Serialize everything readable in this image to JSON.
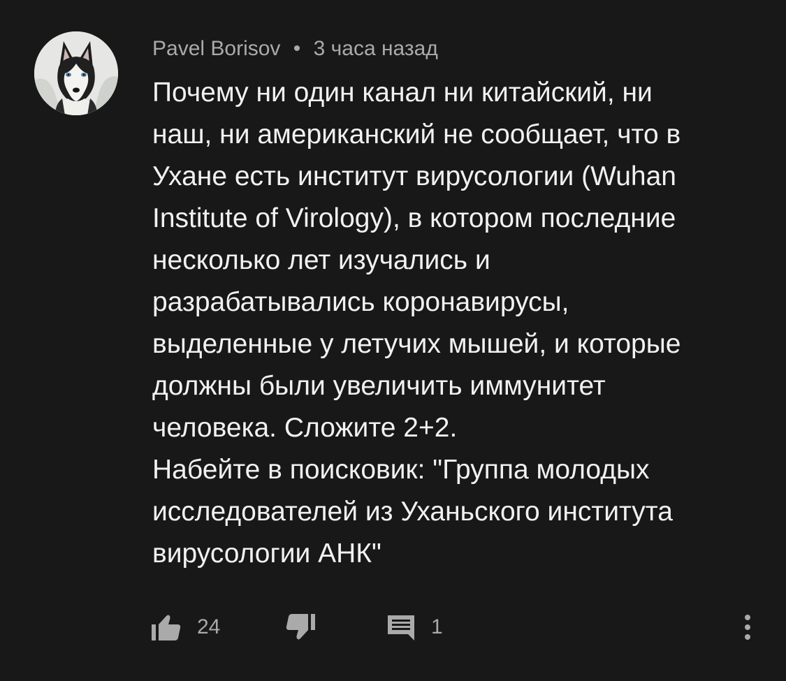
{
  "comment": {
    "author": "Pavel Borisov",
    "separator": "•",
    "time": "3 часа назад",
    "text_lines": [
      "Почему ни один канал ни китайский, ни",
      "наш, ни американский не сообщает, что в",
      "Ухане есть институт вирусологии (Wuhan",
      "Institute of Virology), в котором последние",
      "несколько лет изучались и",
      "разрабатывались коронавирусы,",
      "выделенные у летучих мышей, и которые",
      "должны были увеличить иммунитет",
      "человека. Сложите 2+2.",
      "Набейте в поисковик: \"Группа молодых",
      "исследователей из Уханьского института",
      "вирусологии АНК\""
    ],
    "likes": "24",
    "replies": "1"
  },
  "icons": {
    "like": "thumbs-up-icon",
    "dislike": "thumbs-down-icon",
    "reply": "comment-reply-icon",
    "more": "vertical-dots-icon",
    "avatar": "husky-dog-avatar"
  },
  "colors": {
    "background": "#181818",
    "text": "#f1f1f1",
    "secondary": "#aaaaaa"
  }
}
